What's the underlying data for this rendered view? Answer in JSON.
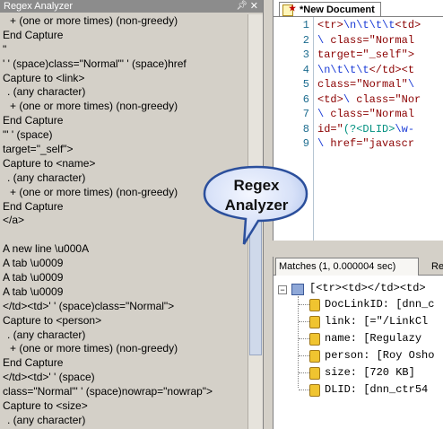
{
  "left_panel": {
    "title": "Regex Analyzer",
    "pin_icon": "pin-icon",
    "close_icon": "close-icon",
    "lines": [
      {
        "text": "+ (one or more times) (non-greedy)",
        "indent": 1
      },
      {
        "text": "End Capture",
        "indent": 0
      },
      {
        "text": "\"",
        "indent": 0
      },
      {
        "text": "' ' (space)class=\"Normal\"' ' (space)href",
        "indent": 0
      },
      {
        "text": "Capture to <link>",
        "indent": 0
      },
      {
        "text": ". (any character)",
        "indent": 2
      },
      {
        "text": "+ (one or more times) (non-greedy)",
        "indent": 1
      },
      {
        "text": "End Capture",
        "indent": 0
      },
      {
        "text": "\"' ' (space)",
        "indent": 0
      },
      {
        "text": "target=\"_self\">",
        "indent": 0
      },
      {
        "text": "Capture to <name>",
        "indent": 0
      },
      {
        "text": ". (any character)",
        "indent": 2
      },
      {
        "text": "+ (one or more times) (non-greedy)",
        "indent": 1
      },
      {
        "text": "End Capture",
        "indent": 0
      },
      {
        "text": "</a>",
        "indent": 0
      },
      {
        "text": "",
        "indent": 0
      },
      {
        "text": "A new line \\u000A",
        "indent": 0
      },
      {
        "text": "A tab \\u0009",
        "indent": 0
      },
      {
        "text": "A tab \\u0009",
        "indent": 0
      },
      {
        "text": "A tab \\u0009",
        "indent": 0
      },
      {
        "text": "</td><td>' ' (space)class=\"Normal\">",
        "indent": 0
      },
      {
        "text": "Capture to <person>",
        "indent": 0
      },
      {
        "text": ". (any character)",
        "indent": 2
      },
      {
        "text": "+ (one or more times) (non-greedy)",
        "indent": 1
      },
      {
        "text": "End Capture",
        "indent": 0
      },
      {
        "text": "</td><td>' ' (space)",
        "indent": 0
      },
      {
        "text": "class=\"Normal\"' ' (space)nowrap=\"nowrap\">",
        "indent": 0
      },
      {
        "text": "Capture to <size>",
        "indent": 0
      },
      {
        "text": ". (any character)",
        "indent": 2
      }
    ]
  },
  "editor": {
    "tab_label": "*New Document",
    "line_numbers": [
      "1",
      "2",
      "3",
      "4",
      "5",
      "6",
      "7",
      "8",
      "9"
    ],
    "code_lines": [
      [
        {
          "t": "<tr>",
          "c": "str"
        },
        {
          "t": "\\n\\t\\t\\t",
          "c": "esc"
        },
        {
          "t": "<td>",
          "c": "str"
        }
      ],
      [
        {
          "t": "\\ ",
          "c": "esc"
        },
        {
          "t": "class=\"Normal",
          "c": "str"
        }
      ],
      [
        {
          "t": "target=\"_self\">",
          "c": "str"
        }
      ],
      [
        {
          "t": "\\n\\t\\t\\t",
          "c": "esc"
        },
        {
          "t": "</td><t",
          "c": "str"
        }
      ],
      [
        {
          "t": "class=\"Normal\"",
          "c": "str"
        },
        {
          "t": "\\",
          "c": "esc"
        }
      ],
      [
        {
          "t": "<td>",
          "c": "str"
        },
        {
          "t": "\\ ",
          "c": "esc"
        },
        {
          "t": "class=\"Nor",
          "c": "str"
        }
      ],
      [
        {
          "t": "\\ ",
          "c": "esc"
        },
        {
          "t": "class=\"Normal",
          "c": "str"
        }
      ],
      [
        {
          "t": "id=\"",
          "c": "str"
        },
        {
          "t": "(?<DLID>",
          "c": "grp"
        },
        {
          "t": "\\w-",
          "c": "esc"
        }
      ],
      [
        {
          "t": "\\ ",
          "c": "esc"
        },
        {
          "t": "href=\"javascr",
          "c": "str"
        }
      ]
    ]
  },
  "matches": {
    "tab_label": "Matches (1, 0.000004 sec)",
    "results_tab_label": "Re",
    "root_row": "[<tr><td></td><td>",
    "groups": [
      "DocLinkID: [dnn_c",
      "link: [=\"/LinkCl",
      "name: [Regulazy",
      "person: [Roy Osho",
      "size: [720 KB]",
      "DLID: [dnn_ctr54"
    ]
  },
  "callout": {
    "line1": "Regex",
    "line2": "Analyzer"
  }
}
